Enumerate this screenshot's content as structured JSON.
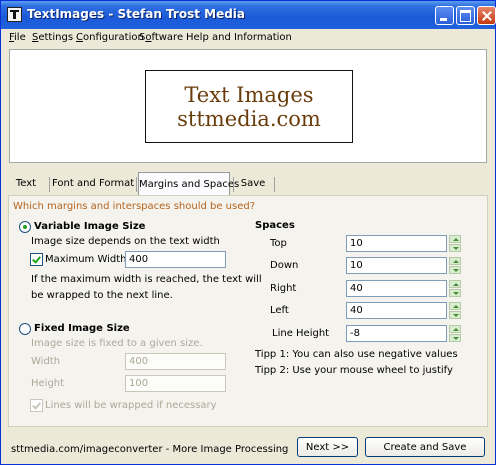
{
  "window": {
    "title": "TextImages - Stefan Trost Media"
  },
  "menu": [
    {
      "pre": "",
      "ul": "F",
      "post": "ile"
    },
    {
      "pre": "",
      "ul": "S",
      "post": "ettings"
    },
    {
      "pre": "",
      "ul": "C",
      "post": "onfiguration"
    },
    {
      "pre": "S",
      "ul": "o",
      "post": "ftware"
    },
    {
      "pre": "",
      "ul": "",
      "post": "Help and Information"
    }
  ],
  "preview": {
    "line1": "Text Images",
    "line2": "sttmedia.com",
    "text_color": "#6a3d0c"
  },
  "tabs": [
    "Text",
    "Font and Format",
    "Margins and Spaces",
    "Save"
  ],
  "active_tab": "Margins and Spaces",
  "panel": {
    "question": "Which margins and interspaces should be used?",
    "variable": {
      "label": "Variable Image Size",
      "selected": true,
      "desc": "Image size depends on the text width",
      "max_width_label": "Maximum Width",
      "max_width_checked": true,
      "max_width_value": "400",
      "wrap_note_1": "If the maximum width is reached, the text will",
      "wrap_note_2": "be wrapped to the next line."
    },
    "fixed": {
      "label": "Fixed Image Size",
      "selected": false,
      "desc": "Image size is fixed to a given size.",
      "width_label": "Width",
      "width_value": "400",
      "height_label": "Height",
      "height_value": "100",
      "wrap_label": "Lines will be wrapped if necessary",
      "wrap_checked": true
    },
    "spaces": {
      "title": "Spaces",
      "top_label": "Top",
      "top_value": "10",
      "down_label": "Down",
      "down_value": "10",
      "right_label": "Right",
      "right_value": "40",
      "left_label": "Left",
      "left_value": "40",
      "line_height_label": "Line Height",
      "line_height_value": "-8"
    },
    "tip1": "Tipp 1: You can also use negative values",
    "tip2": "Tipp 2: Use your mouse wheel to justify"
  },
  "footer": {
    "link": "sttmedia.com/imageconverter - More Image Processing",
    "next_button": "Next >>",
    "save_button": "Create and Save"
  }
}
